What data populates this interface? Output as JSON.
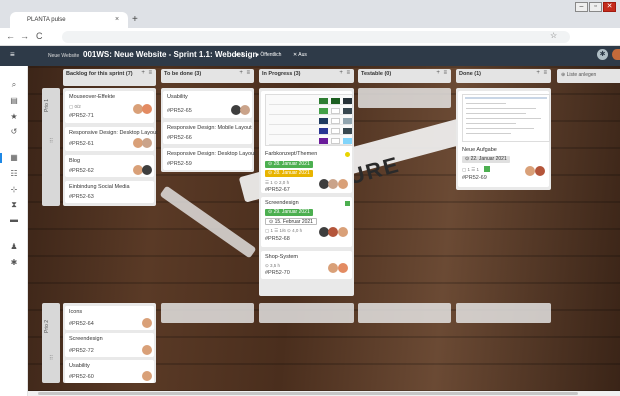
{
  "browser": {
    "tab_title": "PLANTA pulse",
    "tab_close": "×",
    "new_tab": "+",
    "back": "←",
    "forward": "→",
    "reload": "C",
    "star": "☆",
    "window_buttons": [
      "–",
      "▫",
      "✕"
    ]
  },
  "header": {
    "breadcrumb": "Neue Website",
    "board_title": "001WS: Neue Website - Sprint 1.1: Webdesign",
    "favorites": "★ 2",
    "visibility": "● Öffentlich",
    "filter": "✕ Aus"
  },
  "rail": {
    "icons": [
      "search-icon",
      "document-icon",
      "star-icon",
      "history-icon",
      "board-icon",
      "team-icon",
      "hierarchy-icon",
      "hourglass-icon",
      "archive-icon",
      "user-icon",
      "settings-icon"
    ],
    "glyphs": [
      "⌕",
      "▤",
      "★",
      "↺",
      "▦",
      "☷",
      "⊹",
      "⧗",
      "▬",
      "♟",
      "✱"
    ]
  },
  "columns": [
    {
      "title": "Backlog for this sprint",
      "count": "(7)"
    },
    {
      "title": "To be done",
      "count": "(3)"
    },
    {
      "title": "In Progress",
      "count": "(3)"
    },
    {
      "title": "Testable",
      "count": "(0)"
    },
    {
      "title": "Done",
      "count": "(1)"
    }
  ],
  "column_icons": "+ ≡",
  "list_add": "⊕ Liste anlegen",
  "lanes": [
    {
      "label": "Prio 1",
      "grip": "⠿"
    },
    {
      "label": "Prio 2",
      "grip": "⠿"
    }
  ],
  "cards": {
    "backlog_p1": [
      {
        "title": "Mouseover-Effekte",
        "meta": "▢ 0/2",
        "id": "#PR52-71"
      },
      {
        "title": "Responsive Design: Desktop Layout",
        "id": "#PR52-61"
      },
      {
        "title": "Blog",
        "id": "#PR52-62"
      },
      {
        "title": "Einbindung Social Media",
        "id": "#PR52-63"
      }
    ],
    "todo_p1": [
      {
        "title": "Usability",
        "id": "#PR52-65"
      },
      {
        "title": "Responsive Design: Mobile Layout",
        "id": "#PR52-66"
      },
      {
        "title": "Responsive Design: Desktop Layout",
        "id": "#PR52-59"
      }
    ],
    "inprogress_p1": [
      {
        "title": "Farbkonzept/Themen",
        "date1": "⊙ 28. Januar 2021",
        "date2": "⊙ 28. Januar 2021",
        "meta": "☰ 1  ⊙ 2,0 h",
        "id": "#PR52-67"
      },
      {
        "title": "Screendesign",
        "date1": "⊙ 29. Januar 2021",
        "date2": "⊙ 15. Februar 2021",
        "meta": "▢ 1  ☰ 1/6  ⊙ 4,0 h",
        "id": "#PR52-68"
      },
      {
        "title": "Shop-System",
        "meta": "⊙ 3,5 h",
        "id": "#PR52-70"
      }
    ],
    "done_p1": [
      {
        "title": "Neue Aufgabe",
        "date": "⊙ 22. Januar 2021",
        "meta": "▢ 1  ☰ 1",
        "id": "#PR52-69"
      }
    ],
    "backlog_p2": [
      {
        "title": "Icons",
        "id": "#PR52-64"
      },
      {
        "title": "Screendesign",
        "id": "#PR52-72"
      },
      {
        "title": "Usability",
        "id": "#PR52-60"
      }
    ]
  },
  "background": {
    "ribbon_text": "URE"
  },
  "colors": {
    "header_bg": "#2e3a48",
    "accent": "#1e88e5",
    "green": "#4caf50",
    "yellow": "#e8b400"
  }
}
